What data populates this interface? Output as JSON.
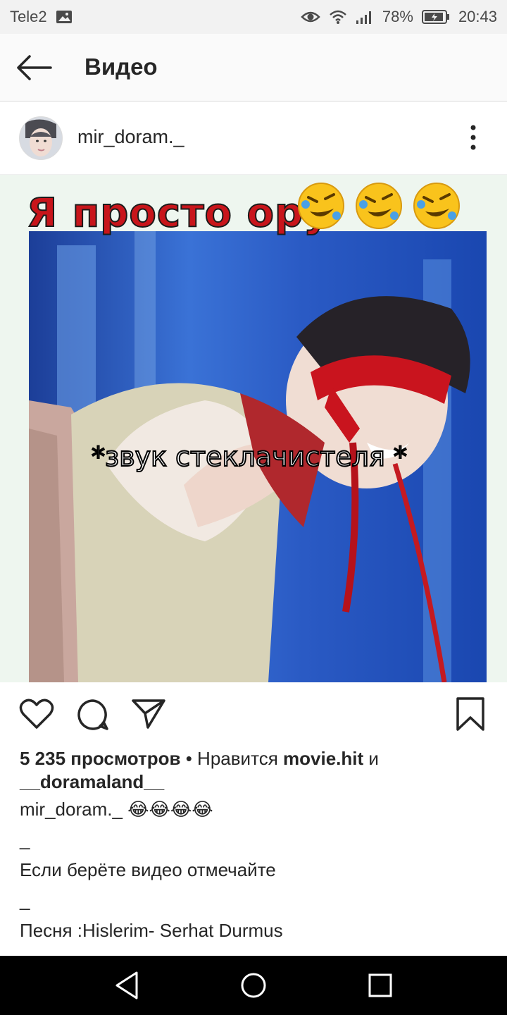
{
  "status_bar": {
    "carrier": "Tele2",
    "battery": "78%",
    "time": "20:43",
    "icons": [
      "gallery-icon",
      "eye-icon",
      "wifi-icon",
      "signal-icon",
      "battery-icon"
    ]
  },
  "app_bar": {
    "title": "Видео",
    "back_icon": "arrow-left-icon"
  },
  "post": {
    "username": "mir_doram._",
    "menu_icon": "more-vertical-icon",
    "media": {
      "top_text": "Я просто ору",
      "top_emoji": "🤣🤣🤣",
      "overlay_text": "*звук стеклачистеля *"
    },
    "actions": [
      "heart-icon",
      "comment-icon",
      "share-icon",
      "bookmark-icon"
    ],
    "views": "5 235 просмотров",
    "liked_prefix": "• Нравится",
    "liked_by": "movie.hit",
    "liked_and": "и",
    "liked_by2": "__doramaland__",
    "caption_user": "mir_doram._",
    "caption_emoji": "😂😂😂😂",
    "caption_lines": [
      "_",
      "Если берёте видео отмечайте",
      "_",
      "Песня :Hislerim- Serhat Durmus",
      "_"
    ]
  },
  "nav_bar": {
    "icons": [
      "back-triangle-icon",
      "home-circle-icon",
      "recents-square-icon"
    ]
  },
  "colors": {
    "status_bg": "#f2f2f2",
    "appbar_bg": "#fafafa",
    "text": "#262626",
    "media_bg": "#eef6ef",
    "nav_bg": "#000000"
  }
}
